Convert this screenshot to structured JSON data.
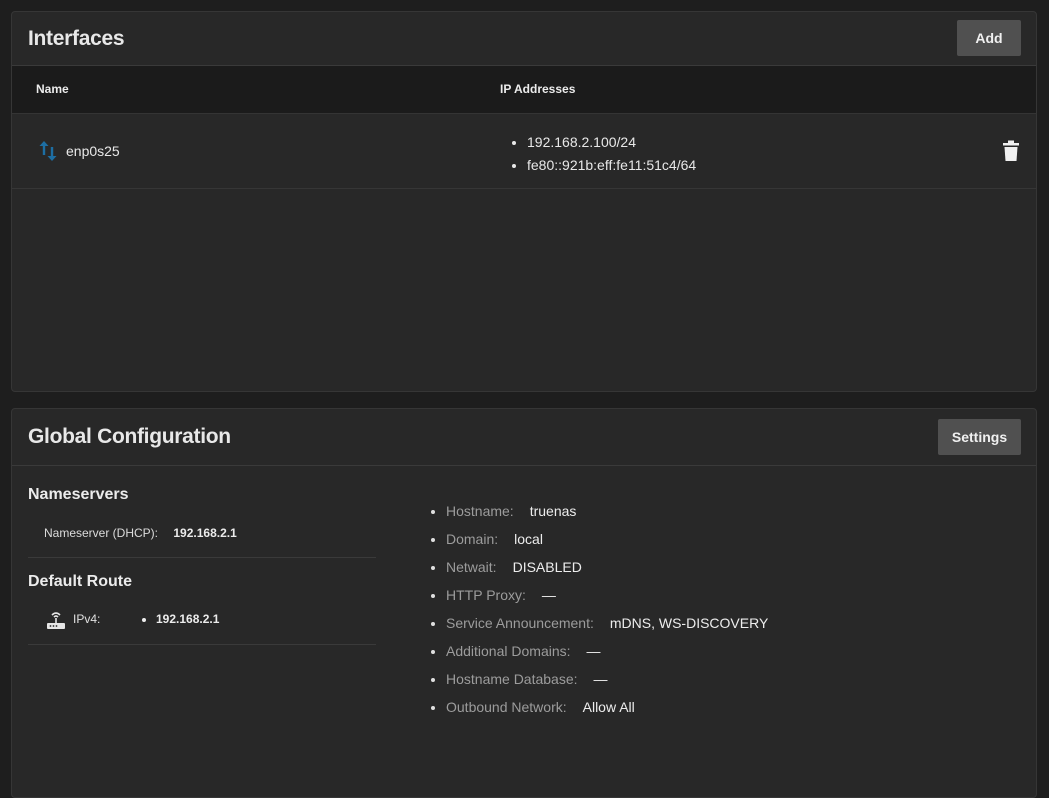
{
  "interfaces": {
    "title": "Interfaces",
    "add_label": "Add",
    "columns": {
      "name": "Name",
      "ip": "IP Addresses"
    },
    "rows": [
      {
        "name": "enp0s25",
        "addresses": [
          "192.168.2.100/24",
          "fe80::921b:eff:fe11:51c4/64"
        ]
      }
    ]
  },
  "global": {
    "title": "Global Configuration",
    "settings_label": "Settings",
    "nameservers": {
      "heading": "Nameservers",
      "items": [
        {
          "label": "Nameserver (DHCP):",
          "value": "192.168.2.1"
        }
      ]
    },
    "default_route": {
      "heading": "Default Route",
      "label": "IPv4:",
      "values": [
        "192.168.2.1"
      ]
    },
    "settings": [
      {
        "label": "Hostname:",
        "value": "truenas"
      },
      {
        "label": "Domain:",
        "value": "local"
      },
      {
        "label": "Netwait:",
        "value": "DISABLED"
      },
      {
        "label": "HTTP Proxy:",
        "value": "—"
      },
      {
        "label": "Service Announcement:",
        "value": "mDNS, WS-DISCOVERY"
      },
      {
        "label": "Additional Domains:",
        "value": "—"
      },
      {
        "label": "Hostname Database:",
        "value": "—"
      },
      {
        "label": "Outbound Network:",
        "value": "Allow All"
      }
    ]
  },
  "colors": {
    "background": "#1e1e1e",
    "card": "#282828",
    "table_header": "#1b1b1b",
    "button": "#505050",
    "accent_icon": "#1d6ea3"
  },
  "icons": {
    "interface": "swap-vertical-icon",
    "delete": "trash-icon",
    "route": "router-icon"
  }
}
